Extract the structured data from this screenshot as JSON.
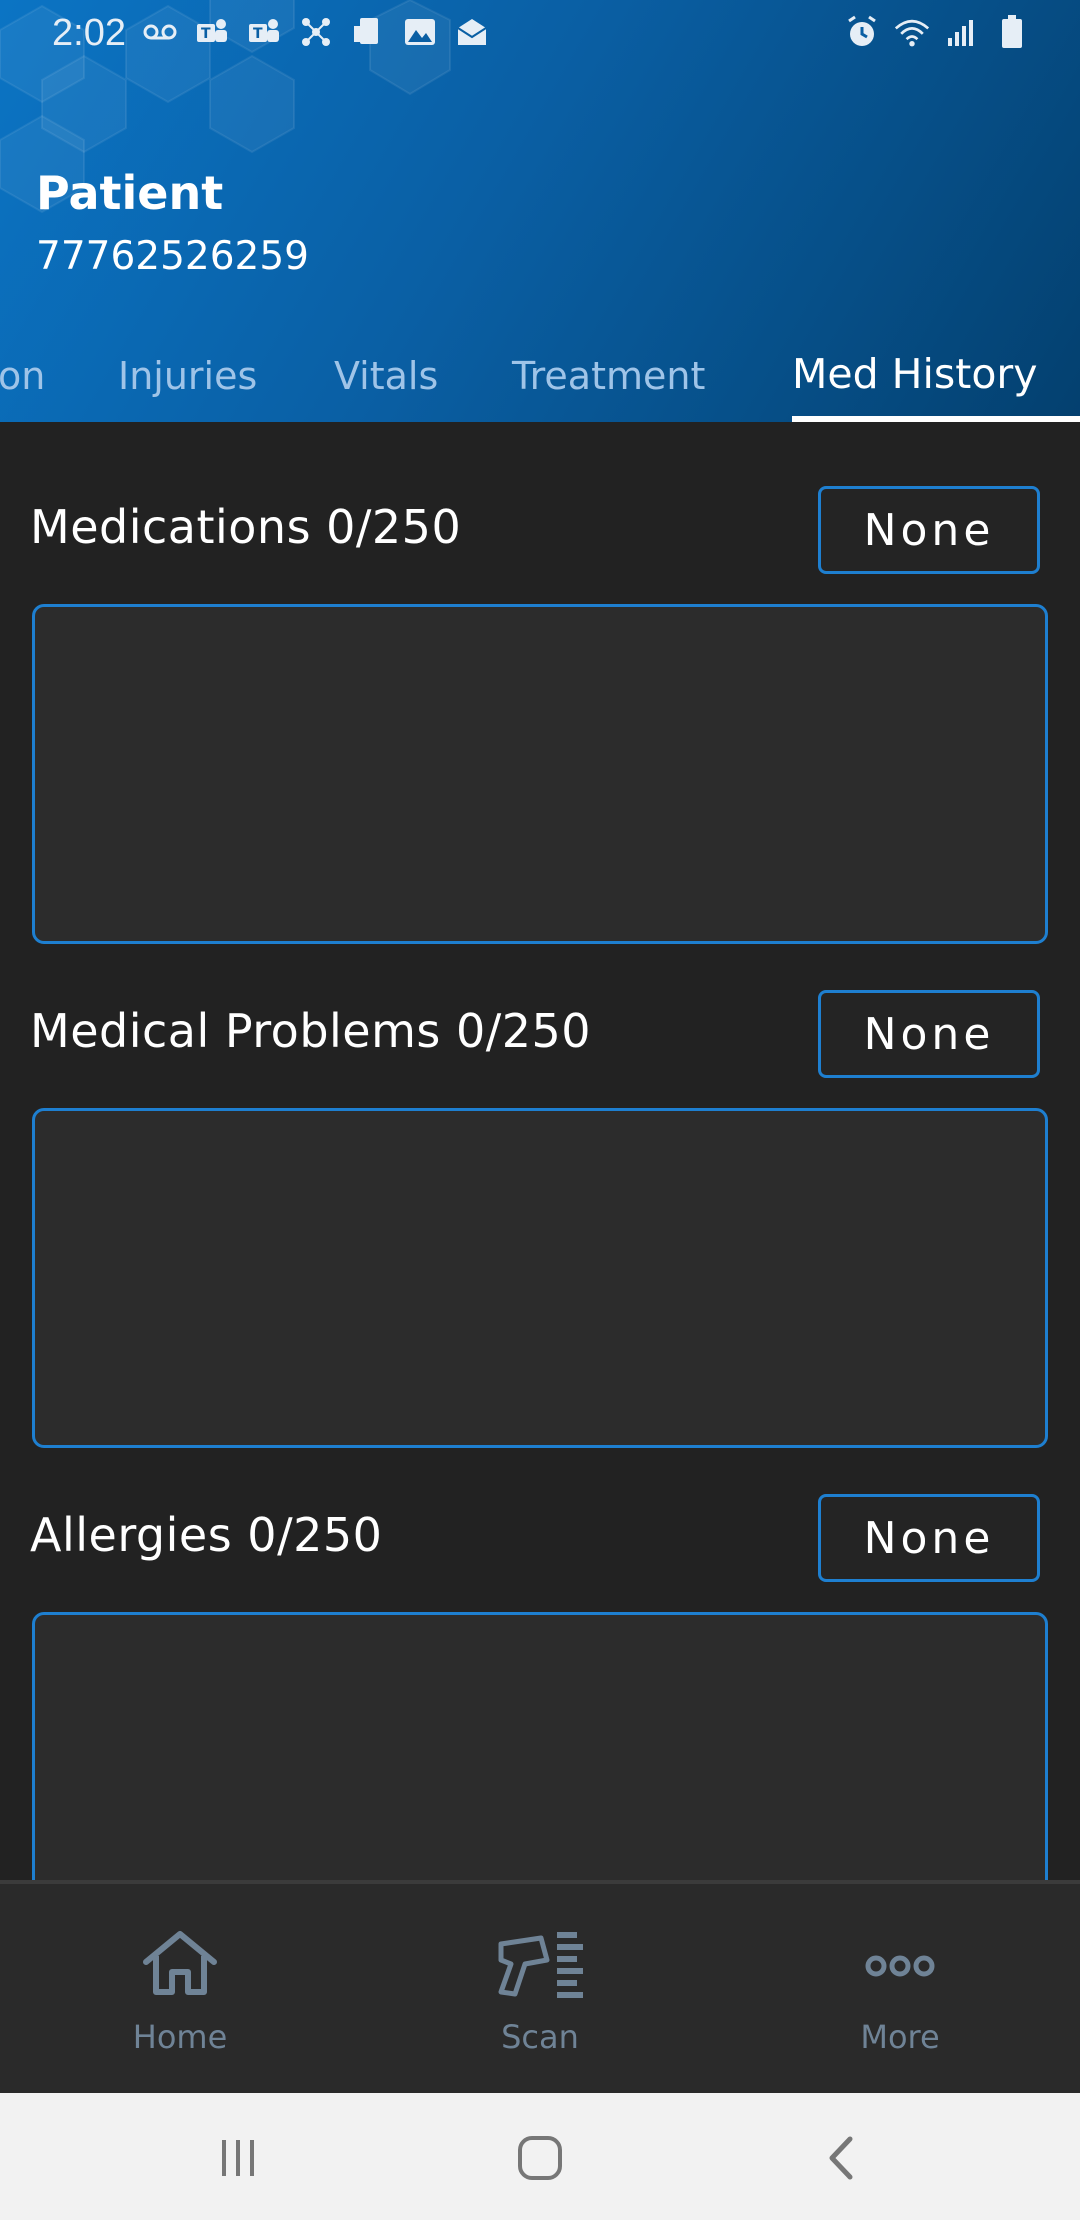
{
  "status_bar": {
    "time": "2:02",
    "left_icons": [
      "voicemail-icon",
      "teams-icon",
      "teams-icon",
      "connection-icon",
      "device-icon",
      "image-icon",
      "mail-icon"
    ],
    "right_icons": [
      "alarm-icon",
      "wifi-icon",
      "signal-icon",
      "battery-icon"
    ]
  },
  "header": {
    "title": "Patient",
    "patient_id": "77762526259"
  },
  "tabs": [
    {
      "label": "on"
    },
    {
      "label": "Injuries"
    },
    {
      "label": "Vitals"
    },
    {
      "label": "Treatment"
    },
    {
      "label": "Med History",
      "active": true
    }
  ],
  "sections": [
    {
      "label": "Medications  0/250",
      "button": "None",
      "value": ""
    },
    {
      "label": "Medical Problems  0/250",
      "button": "None",
      "value": ""
    },
    {
      "label": "Allergies  0/250",
      "button": "None",
      "value": ""
    }
  ],
  "bottom_nav": [
    {
      "label": "Home",
      "icon": "home-icon"
    },
    {
      "label": "Scan",
      "icon": "scanner-icon"
    },
    {
      "label": "More",
      "icon": "more-icon"
    }
  ],
  "system_nav": [
    "recents-icon",
    "home-circle-icon",
    "back-icon"
  ],
  "colors": {
    "header_blue": "#0a5fa4",
    "accent_border": "#1e7fd0",
    "background": "#222222",
    "tab_inactive": "#9fc4e8",
    "nav_label": "#6f8396"
  }
}
